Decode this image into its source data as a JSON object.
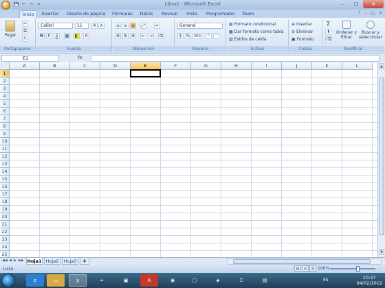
{
  "window": {
    "title": "Libro1 - Microsoft Excel",
    "minimize": "–",
    "maximize": "□",
    "close": "✕"
  },
  "quick_access": [
    "💾",
    "↶",
    "↷",
    "▾"
  ],
  "tabs": [
    "Inicio",
    "Insertar",
    "Diseño de página",
    "Fórmulas",
    "Datos",
    "Revisar",
    "Vista",
    "Programador",
    "Team"
  ],
  "tab_right": [
    "?",
    "–",
    "□",
    "✕"
  ],
  "ribbon": {
    "clipboard": {
      "paste": "Pegar",
      "label": "Portapapeles"
    },
    "font": {
      "name": "Calibri",
      "size": "11",
      "grow": "A",
      "shrink": "A",
      "bold": "N",
      "italic": "K",
      "underline": "S",
      "label": "Fuente"
    },
    "alignment": {
      "label": "Alineación"
    },
    "number": {
      "format": "General",
      "currency": "$",
      "percent": "%",
      "thousands": "000",
      "label": "Número"
    },
    "styles": {
      "conditional": "Formato condicional",
      "table": "Dar formato como tabla",
      "cell": "Estilos de celda",
      "label": "Estilos"
    },
    "cells": {
      "insert": "Insertar",
      "delete": "Eliminar",
      "format": "Formato",
      "label": "Celdas"
    },
    "editing": {
      "sigma": "Σ",
      "sort": "Ordenar y filtrar",
      "find": "Buscar y seleccionar",
      "label": "Modificar"
    }
  },
  "formula_bar": {
    "name_box": "E1",
    "fx": "fx",
    "value": ""
  },
  "columns": [
    "A",
    "B",
    "C",
    "D",
    "E",
    "F",
    "G",
    "H",
    "I",
    "J",
    "K",
    "L"
  ],
  "rows": [
    "1",
    "2",
    "3",
    "4",
    "5",
    "6",
    "7",
    "8",
    "9",
    "10",
    "11",
    "12",
    "13",
    "14",
    "15",
    "16",
    "17",
    "18",
    "19",
    "20",
    "21",
    "22",
    "23",
    "24",
    "25"
  ],
  "selected_cell": "E1",
  "sheets": [
    "Hoja1",
    "Hoja2",
    "Hoja3"
  ],
  "active_sheet": "Hoja1",
  "status": {
    "mode": "Listo",
    "zoom": "100%"
  },
  "taskbar": {
    "lang": "ES",
    "time": "10:37",
    "date": "04/02/2012"
  }
}
